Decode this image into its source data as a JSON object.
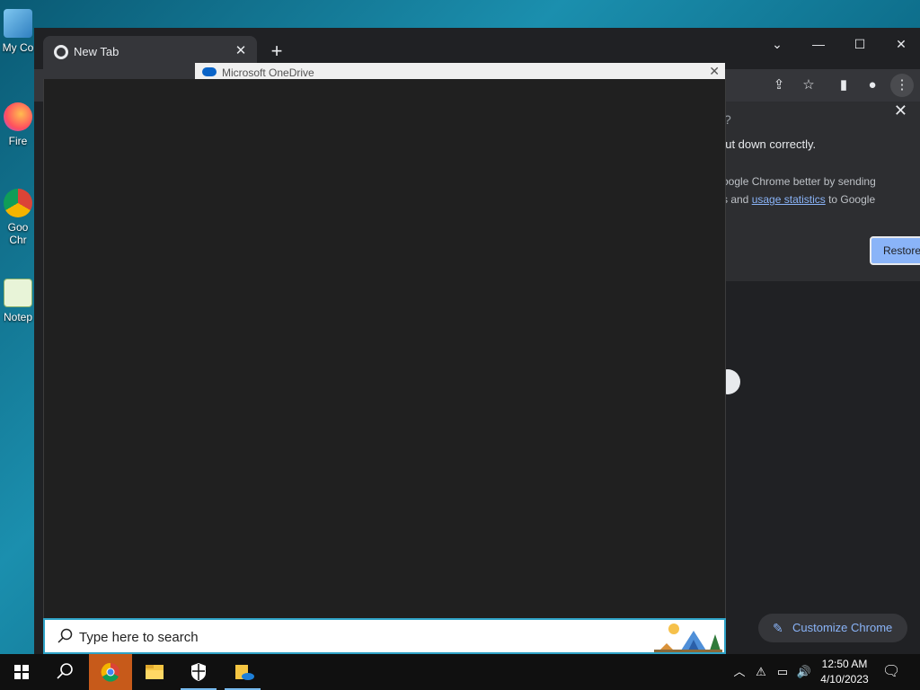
{
  "desktop": {
    "icons": [
      {
        "label": "My Co"
      },
      {
        "label": "Fire"
      },
      {
        "label": "Goo",
        "label2": "Chr"
      },
      {
        "label": "Notep"
      }
    ]
  },
  "chrome": {
    "tab_title": "New Tab",
    "tab_close": "✕",
    "new_tab": "+",
    "window_controls": {
      "dropdown": "⌄",
      "minimize": "—",
      "maximize": "☐",
      "close": "✕"
    },
    "restore_bubble": {
      "question_mark": "?",
      "close": "✕",
      "headline": "hut down correctly.",
      "body_line1": "oogle Chrome better by sending",
      "body_line2_prefix": "s and ",
      "body_link": "usage statistics",
      "body_line2_suffix": " to Google",
      "restore_label": "Restore"
    },
    "customize_label": "Customize Chrome"
  },
  "onedrive": {
    "title": "Microsoft OneDrive",
    "close": "✕"
  },
  "search": {
    "placeholder": "Type here to search"
  },
  "taskbar": {
    "time": "12:50 AM",
    "date": "4/10/2023"
  },
  "colors": {
    "accent": "#8ab4f8",
    "search_border": "#2fa3c7",
    "taskbar_underline": "#76b9ed"
  }
}
